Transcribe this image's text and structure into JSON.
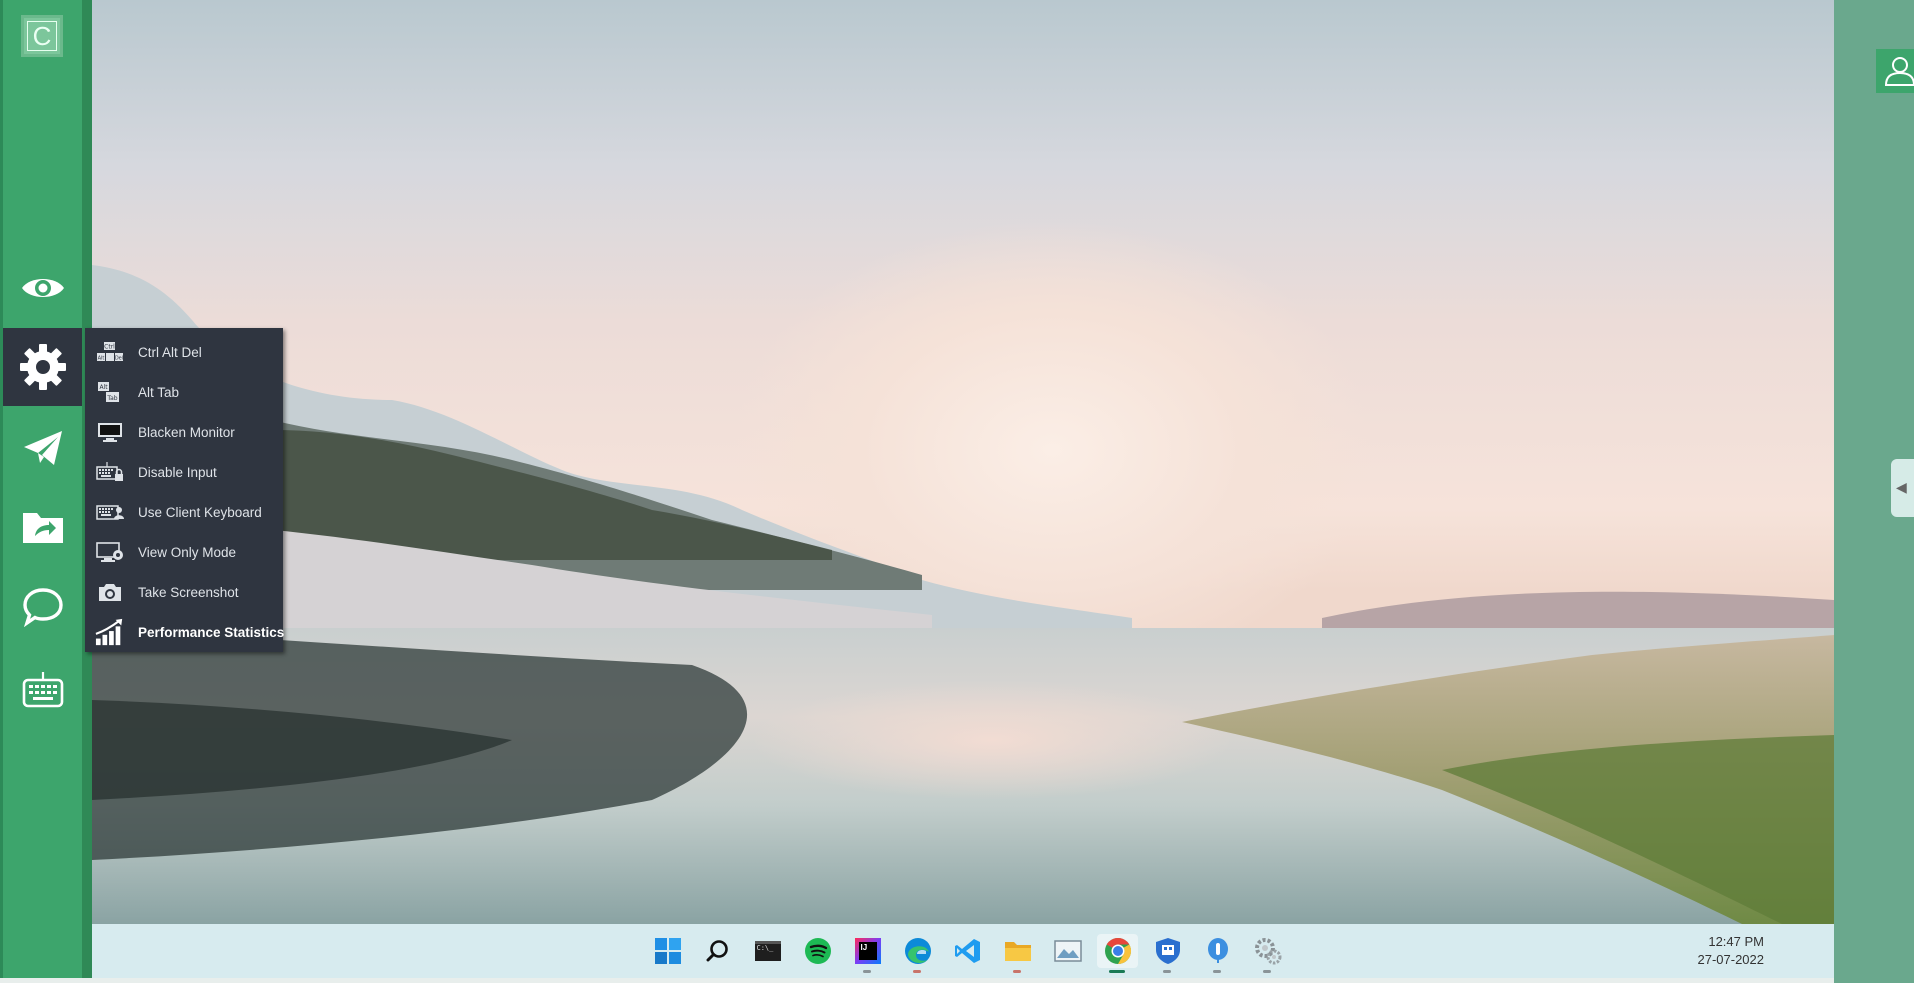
{
  "app": {
    "logo_letter": "C",
    "accent": "#3da56c",
    "menu_bg": "#2f3540"
  },
  "toolbar": {
    "items": [
      {
        "name": "eye-icon",
        "label": ""
      },
      {
        "name": "gear-icon",
        "label": ""
      },
      {
        "name": "paper-plane-icon",
        "label": ""
      },
      {
        "name": "folder-share-icon",
        "label": ""
      },
      {
        "name": "chat-bubble-icon",
        "label": ""
      },
      {
        "name": "keyboard-icon",
        "label": ""
      }
    ]
  },
  "actions_menu": {
    "items": [
      {
        "label": "Ctrl Alt Del",
        "icon": "ctrl-alt-del-keys-icon"
      },
      {
        "label": "Alt Tab",
        "icon": "alt-tab-keys-icon"
      },
      {
        "label": "Blacken Monitor",
        "icon": "monitor-icon"
      },
      {
        "label": "Disable Input",
        "icon": "keyboard-lock-icon"
      },
      {
        "label": "Use Client Keyboard",
        "icon": "keyboard-user-icon"
      },
      {
        "label": "View Only Mode",
        "icon": "monitor-eye-icon"
      },
      {
        "label": "Take Screenshot",
        "icon": "camera-icon"
      },
      {
        "label": "Performance Statistics",
        "icon": "bar-chart-icon"
      }
    ],
    "key_caps": {
      "ctrl": "Ctrl",
      "alt": "Alt",
      "del": "Del",
      "tab": "Tab"
    }
  },
  "taskbar": {
    "icons": [
      "windows-start-icon",
      "search-icon",
      "terminal-icon",
      "spotify-icon",
      "intellij-icon",
      "edge-icon",
      "vscode-icon",
      "file-explorer-icon",
      "photos-icon",
      "chrome-icon",
      "windows-security-icon",
      "pin-app-icon",
      "settings-icon"
    ],
    "terminal_text": "C:\\_",
    "intellij_text": "IJ",
    "time": "12:47 PM",
    "date": "27-07-2022"
  },
  "right_panel": {
    "collapse_arrow": "◀"
  }
}
